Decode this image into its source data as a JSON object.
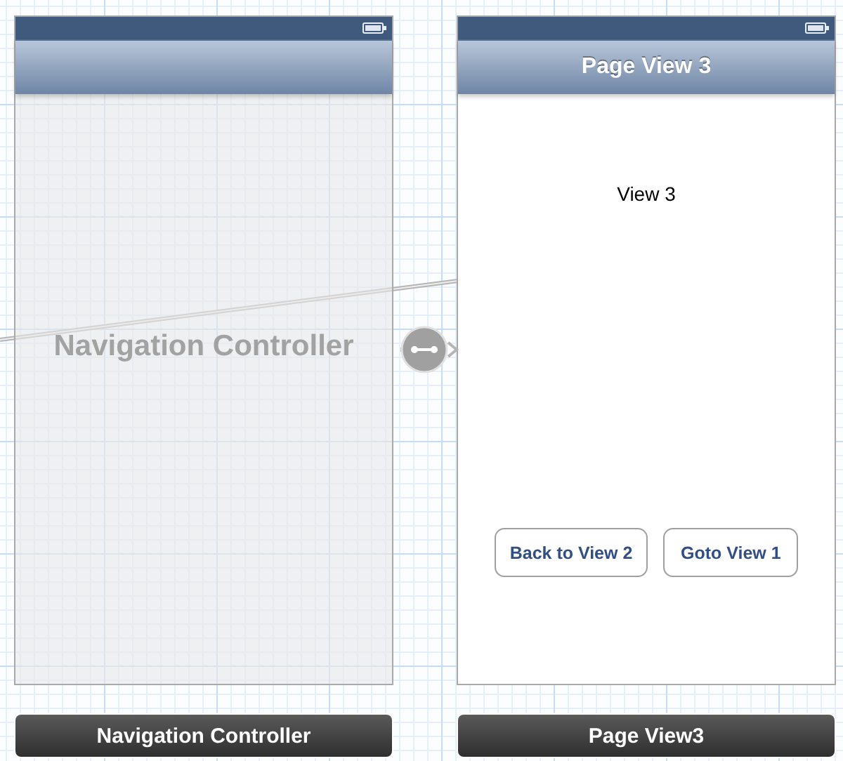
{
  "scenes": [
    {
      "kind": "navigation",
      "watermark": "Navigation Controller",
      "name": "Navigation Controller"
    },
    {
      "kind": "view",
      "title": "Page View 3",
      "label": "View 3",
      "buttons": [
        "Back to View 2",
        "Goto View 1"
      ],
      "name": "Page View3"
    }
  ]
}
